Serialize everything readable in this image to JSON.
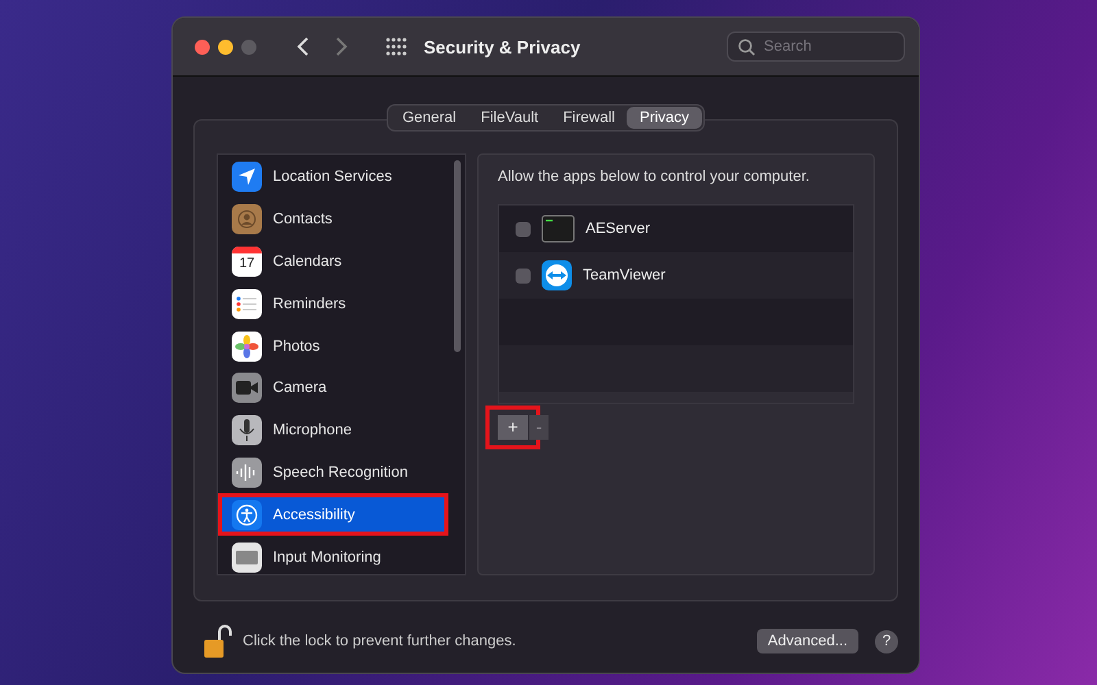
{
  "window": {
    "title": "Security & Privacy"
  },
  "search": {
    "placeholder": "Search"
  },
  "tabs": [
    {
      "label": "General",
      "selected": false
    },
    {
      "label": "FileVault",
      "selected": false
    },
    {
      "label": "Firewall",
      "selected": false
    },
    {
      "label": "Privacy",
      "selected": true
    }
  ],
  "sidebar": {
    "items": [
      {
        "label": "Location Services",
        "kind": "location",
        "selected": false,
        "callout": false
      },
      {
        "label": "Contacts",
        "kind": "contacts",
        "selected": false,
        "callout": false
      },
      {
        "label": "Calendars",
        "kind": "calendar",
        "icon_text": "17",
        "selected": false,
        "callout": false
      },
      {
        "label": "Reminders",
        "kind": "reminders",
        "selected": false,
        "callout": false
      },
      {
        "label": "Photos",
        "kind": "photos",
        "selected": false,
        "callout": false
      },
      {
        "label": "Camera",
        "kind": "camera",
        "selected": false,
        "callout": false
      },
      {
        "label": "Microphone",
        "kind": "microphone",
        "selected": false,
        "callout": false
      },
      {
        "label": "Speech Recognition",
        "kind": "speech",
        "selected": false,
        "callout": false
      },
      {
        "label": "Accessibility",
        "kind": "accessibility",
        "selected": true,
        "callout": true
      },
      {
        "label": "Input Monitoring",
        "kind": "keyboard",
        "selected": false,
        "callout": false
      }
    ]
  },
  "panel": {
    "description": "Allow the apps below to control your computer.",
    "apps": [
      {
        "name": "AEServer",
        "kind": "terminal",
        "checked": false
      },
      {
        "name": "TeamViewer",
        "kind": "teamviewer",
        "checked": false
      }
    ],
    "add_button": {
      "label": "+",
      "callout": true
    },
    "remove_button": {
      "label": "-",
      "disabled": true
    }
  },
  "footer": {
    "lock_text": "Click the lock to prevent further changes.",
    "locked": false,
    "advanced_button": "Advanced...",
    "help_button": "?"
  }
}
